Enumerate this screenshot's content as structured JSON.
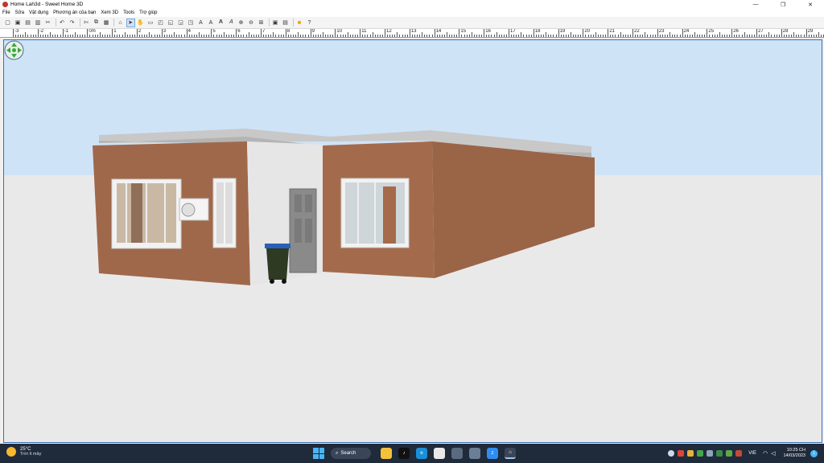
{
  "window": {
    "title": "Home Lah3d - Sweet Home 3D",
    "minimize_icon": "—",
    "maximize_icon": "❐",
    "close_icon": "✕"
  },
  "menu": [
    "File",
    "Sửa",
    "Vật dụng",
    "Phương án của bạn",
    "Xem 3D",
    "Tools",
    "Trợ giúp"
  ],
  "ruler": {
    "labels": [
      "-3",
      "-2",
      "-1",
      "0m",
      "1",
      "2",
      "3",
      "4",
      "5",
      "6",
      "7",
      "8",
      "9",
      "10",
      "11",
      "12",
      "13",
      "14",
      "15",
      "16",
      "17",
      "18",
      "19",
      "20",
      "21",
      "22",
      "23",
      "24",
      "25",
      "26",
      "27",
      "28",
      "29"
    ]
  },
  "taskbar": {
    "weather_temp": "25°C",
    "weather_desc": "Trời ít mây",
    "search_label": "Search",
    "language": "VIE",
    "time": "10:25 CH",
    "date": "14/03/2023",
    "notifications": "1"
  },
  "colors": {
    "sky": "#cfe3f7",
    "ground": "#e9e9e9",
    "brick": "#a0684a",
    "accent": "#3b6fb0"
  }
}
